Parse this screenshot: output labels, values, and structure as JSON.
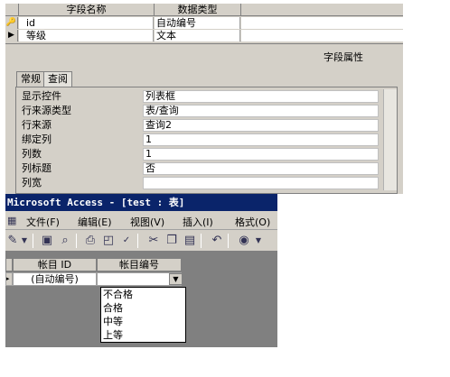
{
  "design": {
    "col_field_name": "字段名称",
    "col_data_type": "数据类型",
    "rows": [
      {
        "key_icon": "🔑",
        "name": "id",
        "type": "自动编号"
      },
      {
        "key_icon": "▶",
        "name": "等级",
        "type": "文本"
      }
    ],
    "props_title": "字段属性",
    "tabs": [
      "常规",
      "查阅"
    ],
    "props": [
      {
        "label": "显示控件",
        "value": "列表框"
      },
      {
        "label": "行来源类型",
        "value": "表/查询"
      },
      {
        "label": "行来源",
        "value": "查询2"
      },
      {
        "label": "绑定列",
        "value": "1"
      },
      {
        "label": "列数",
        "value": "1"
      },
      {
        "label": "列标题",
        "value": "否"
      },
      {
        "label": "列宽",
        "value": ""
      }
    ]
  },
  "access": {
    "title": "Microsoft Access - [test : 表]",
    "menus": [
      "文件(F)",
      "编辑(E)",
      "视图(V)",
      "插入(I)",
      "格式(O)"
    ],
    "toolbar_icons": [
      "design-view-icon",
      "save-icon",
      "print-preview-icon",
      "print-icon",
      "preview-icon",
      "spell-icon",
      "cut-icon",
      "copy-icon",
      "paste-icon",
      "undo-icon",
      "web-icon"
    ],
    "datasheet": {
      "col1": "帐目 ID",
      "col2": "帐目编号",
      "row_value": "(自动编号)"
    },
    "dropdown_options": [
      "不合格",
      "合格",
      "中等",
      "上等"
    ]
  }
}
